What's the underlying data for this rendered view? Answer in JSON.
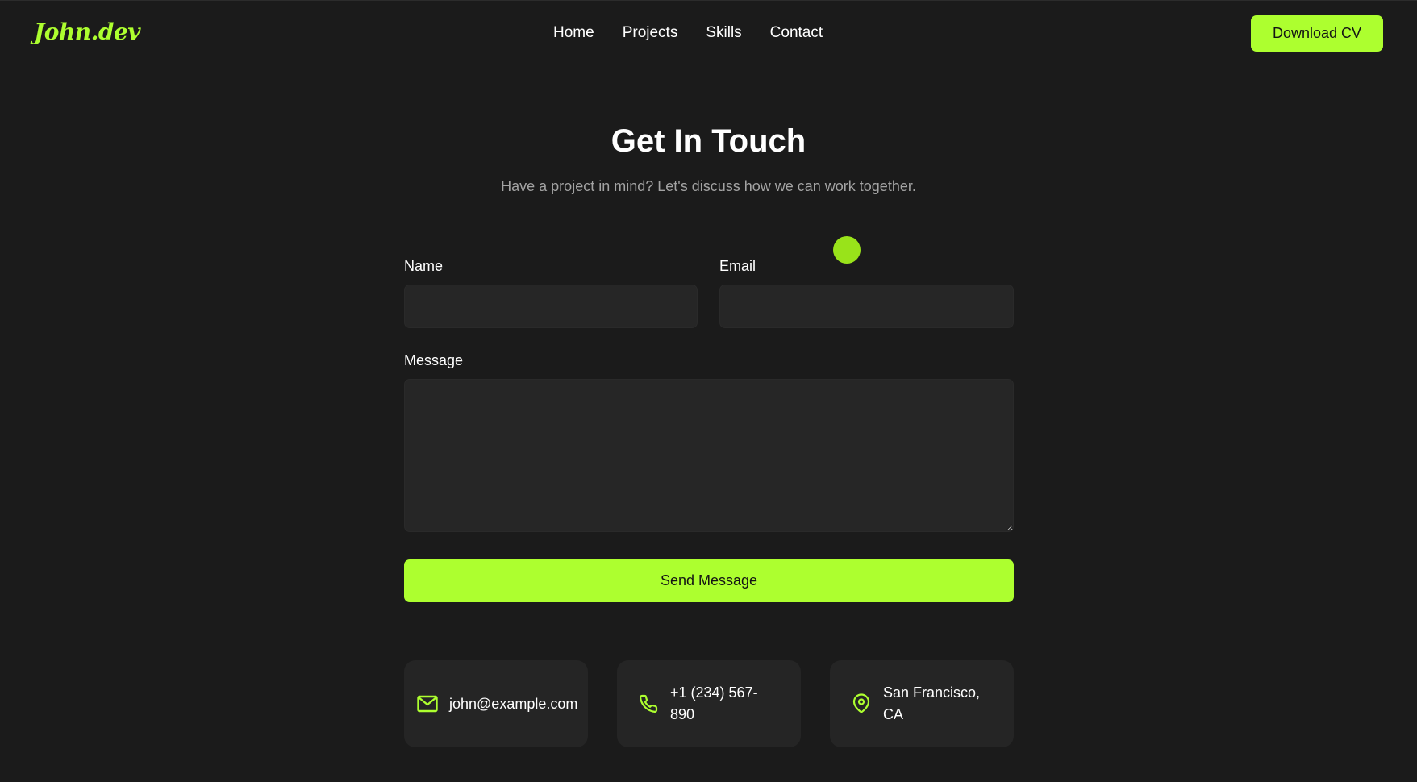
{
  "header": {
    "logo": "John.dev",
    "nav": [
      "Home",
      "Projects",
      "Skills",
      "Contact"
    ],
    "cv_button": "Download CV"
  },
  "hero": {
    "title": "Get In Touch",
    "subtitle": "Have a project in mind? Let's discuss how we can work together."
  },
  "form": {
    "name_label": "Name",
    "name_value": "",
    "email_label": "Email",
    "email_value": "",
    "message_label": "Message",
    "message_value": "",
    "submit_label": "Send Message"
  },
  "contacts": {
    "email": "john@example.com",
    "phone_line1": "+1 (234) 567-",
    "phone_line2": "890",
    "location_line1": "San Francisco,",
    "location_line2": "CA"
  },
  "icons": {
    "email": "mail-icon",
    "phone": "phone-icon",
    "location": "map-pin-icon"
  },
  "colors": {
    "accent": "#adff2f",
    "background": "#1b1b1b",
    "surface": "#252525",
    "muted_text": "#a3a3a3"
  }
}
